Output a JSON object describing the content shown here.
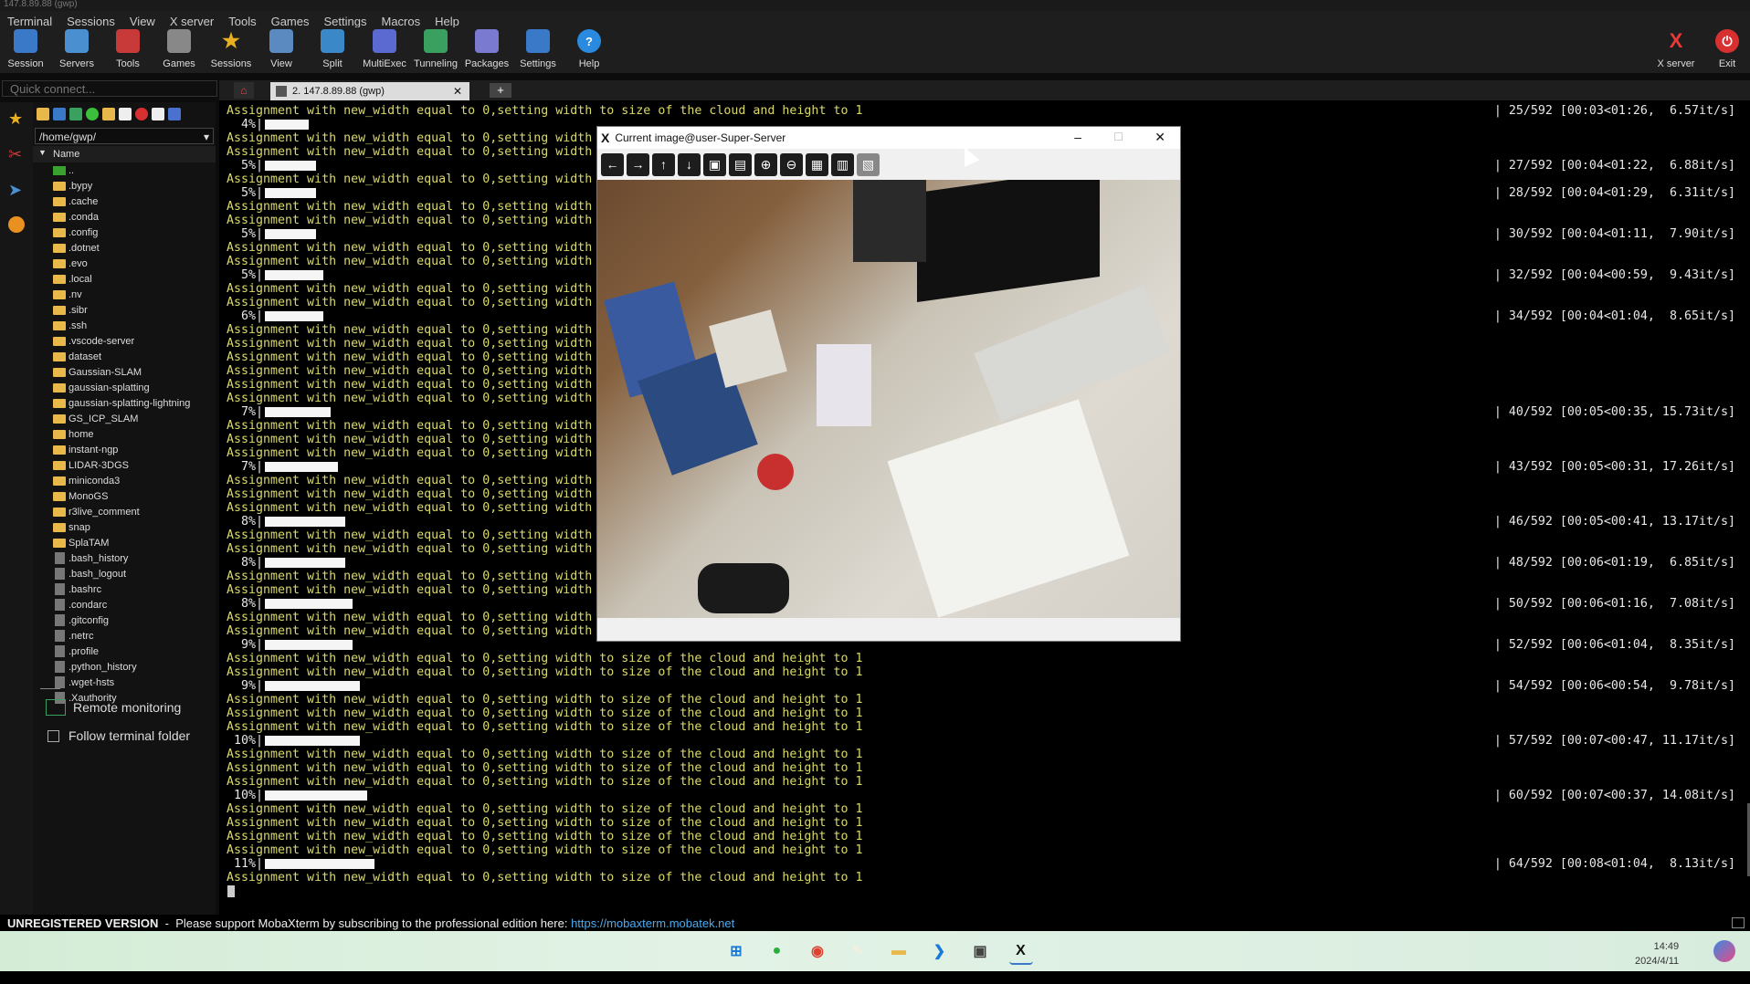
{
  "window": {
    "title": "147.8.89.88 (gwp)"
  },
  "menu": [
    "Terminal",
    "Sessions",
    "View",
    "X server",
    "Tools",
    "Games",
    "Settings",
    "Macros",
    "Help"
  ],
  "toolbar": [
    {
      "label": "Session",
      "icon": "session-icon",
      "color": "#3a78c8"
    },
    {
      "label": "Servers",
      "icon": "servers-icon",
      "color": "#4a90d0"
    },
    {
      "label": "Tools",
      "icon": "tools-icon",
      "color": "#c83a3a"
    },
    {
      "label": "Games",
      "icon": "games-icon",
      "color": "#888888"
    },
    {
      "label": "Sessions",
      "icon": "star-icon",
      "color": "#e8b020"
    },
    {
      "label": "View",
      "icon": "view-icon",
      "color": "#5a8ac0"
    },
    {
      "label": "Split",
      "icon": "split-icon",
      "color": "#3a88c8"
    },
    {
      "label": "MultiExec",
      "icon": "multiexec-icon",
      "color": "#5a6ad0"
    },
    {
      "label": "Tunneling",
      "icon": "tunneling-icon",
      "color": "#3aa060"
    },
    {
      "label": "Packages",
      "icon": "packages-icon",
      "color": "#7a7ad0"
    },
    {
      "label": "Settings",
      "icon": "settings-icon",
      "color": "#3a78c8"
    },
    {
      "label": "Help",
      "icon": "help-icon",
      "color": "#2a8ae0"
    }
  ],
  "toolbar_right": [
    {
      "label": "X server",
      "icon": "x-server-icon"
    },
    {
      "label": "Exit",
      "icon": "power-icon"
    }
  ],
  "quick_connect": {
    "placeholder": "Quick connect..."
  },
  "tab": {
    "label": "2. 147.8.89.88 (gwp)"
  },
  "sftp": {
    "path": "/home/gwp/",
    "column": "Name",
    "items": [
      {
        "name": "..",
        "type": "up"
      },
      {
        "name": ".bypy",
        "type": "folder"
      },
      {
        "name": ".cache",
        "type": "folder"
      },
      {
        "name": ".conda",
        "type": "folder"
      },
      {
        "name": ".config",
        "type": "folder"
      },
      {
        "name": ".dotnet",
        "type": "folder"
      },
      {
        "name": ".evo",
        "type": "folder"
      },
      {
        "name": ".local",
        "type": "folder"
      },
      {
        "name": ".nv",
        "type": "folder"
      },
      {
        "name": ".sibr",
        "type": "folder"
      },
      {
        "name": ".ssh",
        "type": "folder"
      },
      {
        "name": ".vscode-server",
        "type": "folder"
      },
      {
        "name": "dataset",
        "type": "folder"
      },
      {
        "name": "Gaussian-SLAM",
        "type": "folder"
      },
      {
        "name": "gaussian-splatting",
        "type": "folder"
      },
      {
        "name": "gaussian-splatting-lightning",
        "type": "folder"
      },
      {
        "name": "GS_ICP_SLAM",
        "type": "folder"
      },
      {
        "name": "home",
        "type": "folder"
      },
      {
        "name": "instant-ngp",
        "type": "folder"
      },
      {
        "name": "LIDAR-3DGS",
        "type": "folder"
      },
      {
        "name": "miniconda3",
        "type": "folder"
      },
      {
        "name": "MonoGS",
        "type": "folder"
      },
      {
        "name": "r3live_comment",
        "type": "folder"
      },
      {
        "name": "snap",
        "type": "folder"
      },
      {
        "name": "SplaTAM",
        "type": "folder"
      },
      {
        "name": ".bash_history",
        "type": "file"
      },
      {
        "name": ".bash_logout",
        "type": "file"
      },
      {
        "name": ".bashrc",
        "type": "file"
      },
      {
        "name": ".condarc",
        "type": "file"
      },
      {
        "name": ".gitconfig",
        "type": "file"
      },
      {
        "name": ".netrc",
        "type": "file"
      },
      {
        "name": ".profile",
        "type": "file"
      },
      {
        "name": ".python_history",
        "type": "file"
      },
      {
        "name": ".wget-hsts",
        "type": "file"
      },
      {
        "name": ".Xauthority",
        "type": "file"
      }
    ],
    "remote_monitoring": "Remote monitoring",
    "follow_folder": "Follow terminal folder"
  },
  "terminal": {
    "msg_full": "Assignment with new_width equal to 0,setting width to size of the cloud and height to 1",
    "msg_cut": "Assignment with new_width equal to 0,setting width",
    "lines": [
      {
        "k": "f"
      },
      {
        "k": "p",
        "pct": "  4%|",
        "n": 6
      },
      {
        "k": "c"
      },
      {
        "k": "c"
      },
      {
        "k": "p",
        "pct": "  5%|",
        "n": 7
      },
      {
        "k": "c"
      },
      {
        "k": "p",
        "pct": "  5%|",
        "n": 7
      },
      {
        "k": "c"
      },
      {
        "k": "c"
      },
      {
        "k": "p",
        "pct": "  5%|",
        "n": 7
      },
      {
        "k": "c"
      },
      {
        "k": "c"
      },
      {
        "k": "p",
        "pct": "  5%|",
        "n": 8
      },
      {
        "k": "c"
      },
      {
        "k": "c"
      },
      {
        "k": "p",
        "pct": "  6%|",
        "n": 8
      },
      {
        "k": "c"
      },
      {
        "k": "c"
      },
      {
        "k": "c"
      },
      {
        "k": "c"
      },
      {
        "k": "c"
      },
      {
        "k": "c"
      },
      {
        "k": "p",
        "pct": "  7%|",
        "n": 9
      },
      {
        "k": "c"
      },
      {
        "k": "c"
      },
      {
        "k": "c"
      },
      {
        "k": "p",
        "pct": "  7%|",
        "n": 10
      },
      {
        "k": "c"
      },
      {
        "k": "c"
      },
      {
        "k": "c"
      },
      {
        "k": "p",
        "pct": "  8%|",
        "n": 11
      },
      {
        "k": "c"
      },
      {
        "k": "c"
      },
      {
        "k": "p",
        "pct": "  8%|",
        "n": 11
      },
      {
        "k": "c"
      },
      {
        "k": "c"
      },
      {
        "k": "p",
        "pct": "  8%|",
        "n": 12
      },
      {
        "k": "c"
      },
      {
        "k": "c"
      },
      {
        "k": "p",
        "pct": "  9%|",
        "n": 12
      },
      {
        "k": "f"
      },
      {
        "k": "f"
      },
      {
        "k": "p",
        "pct": "  9%|",
        "n": 13
      },
      {
        "k": "f"
      },
      {
        "k": "f"
      },
      {
        "k": "f"
      },
      {
        "k": "p",
        "pct": " 10%|",
        "n": 13
      },
      {
        "k": "f"
      },
      {
        "k": "f"
      },
      {
        "k": "f"
      },
      {
        "k": "p",
        "pct": " 10%|",
        "n": 14
      },
      {
        "k": "f"
      },
      {
        "k": "f"
      },
      {
        "k": "f"
      },
      {
        "k": "f"
      },
      {
        "k": "p",
        "pct": " 11%|",
        "n": 15
      },
      {
        "k": "f"
      },
      {
        "k": "cursor"
      }
    ],
    "progress": [
      {
        "line": 0,
        "text": "| 25/592 [00:03<01:26,  6.57it/s]"
      },
      {
        "line": 4,
        "text": "| 27/592 [00:04<01:22,  6.88it/s]"
      },
      {
        "line": 6,
        "text": "| 28/592 [00:04<01:29,  6.31it/s]"
      },
      {
        "line": 9,
        "text": "| 30/592 [00:04<01:11,  7.90it/s]"
      },
      {
        "line": 12,
        "text": "| 32/592 [00:04<00:59,  9.43it/s]"
      },
      {
        "line": 15,
        "text": "| 34/592 [00:04<01:04,  8.65it/s]"
      },
      {
        "line": 22,
        "text": "| 40/592 [00:05<00:35, 15.73it/s]"
      },
      {
        "line": 26,
        "text": "| 43/592 [00:05<00:31, 17.26it/s]"
      },
      {
        "line": 30,
        "text": "| 46/592 [00:05<00:41, 13.17it/s]"
      },
      {
        "line": 33,
        "text": "| 48/592 [00:06<01:19,  6.85it/s]"
      },
      {
        "line": 36,
        "text": "| 50/592 [00:06<01:16,  7.08it/s]"
      },
      {
        "line": 39,
        "text": "| 52/592 [00:06<01:04,  8.35it/s]"
      },
      {
        "line": 42,
        "text": "| 54/592 [00:06<00:54,  9.78it/s]"
      },
      {
        "line": 46,
        "text": "| 57/592 [00:07<00:47, 11.17it/s]"
      },
      {
        "line": 50,
        "text": "| 60/592 [00:07<00:37, 14.08it/s]"
      },
      {
        "line": 55,
        "text": "| 64/592 [00:08<01:04,  8.13it/s]"
      }
    ]
  },
  "image_window": {
    "title": "Current image@user-Super-Server",
    "tools": [
      "arrow-left-icon",
      "arrow-right-icon",
      "arrow-up-icon",
      "arrow-down-icon",
      "fit-icon",
      "actual-size-icon",
      "zoom-in-icon",
      "zoom-out-icon",
      "save-icon",
      "copy-icon",
      "settings-icon"
    ],
    "tool_glyphs": [
      "←",
      "→",
      "↑",
      "↓",
      "▣",
      "▤",
      "⊕",
      "⊖",
      "▦",
      "▥",
      "▧"
    ]
  },
  "status": {
    "unregistered": "UNREGISTERED VERSION",
    "message": "  -  Please support MobaXterm by subscribing to the professional edition here: ",
    "link": "https://mobaxterm.mobatek.net"
  },
  "taskbar": {
    "time": "14:49",
    "date": "2024/4/11",
    "apps": [
      {
        "name": "windows-start-icon",
        "color": "#1a7ad8",
        "glyph": "⊞"
      },
      {
        "name": "wechat-icon",
        "color": "#2aae3a",
        "glyph": "●"
      },
      {
        "name": "chrome-icon",
        "color": "#e04030",
        "glyph": "◉"
      },
      {
        "name": "feather-icon",
        "color": "#f0f0e0",
        "glyph": "✎"
      },
      {
        "name": "file-explorer-icon",
        "color": "#e8b84a",
        "glyph": "▬"
      },
      {
        "name": "vscode-icon",
        "color": "#1a7ad8",
        "glyph": "❯"
      },
      {
        "name": "terminal-app-icon",
        "color": "#444444",
        "glyph": "▣"
      },
      {
        "name": "mobaxterm-icon",
        "color": "#111111",
        "glyph": "X"
      }
    ]
  }
}
